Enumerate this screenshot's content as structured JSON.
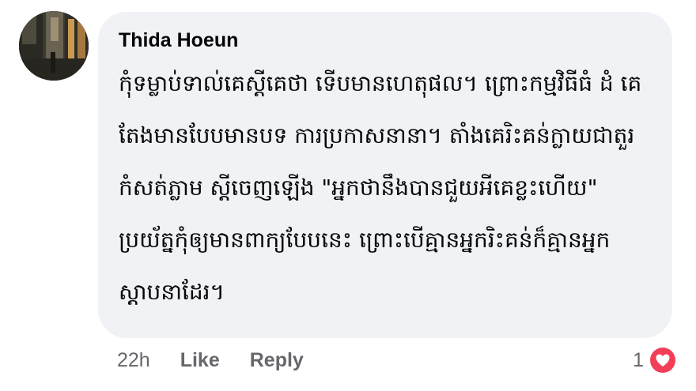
{
  "comment": {
    "author": "Thida Hoeun",
    "text": "កុំទម្លាប់ទាល់គេស្តីគេថា ទើបមានហេតុផល។ ព្រោះកម្មវិធីធំ ដំ គេតែងមានបែបមានបទ ការប្រកាសនានា។ តាំងគេរិះគន់ក្លាយជាតួរកំសត់ភ្លាម ស្តីចេញឡើង \"អ្នកថានឹងបានជួយអីគេខ្លះហើយ\" ប្រយ័ត្នកុំឲ្យមានពាក្យបែបនេះ ព្រោះបើគ្មានអ្នករិះគន់ក៏គ្មានអ្នកស្តាបនាដែរ។",
    "timestamp": "22h",
    "like_label": "Like",
    "reply_label": "Reply",
    "reaction_count": "1",
    "reaction_icon": "heart-icon",
    "reaction_color": "#f33e58",
    "bubble_color": "#f0f2f5"
  }
}
